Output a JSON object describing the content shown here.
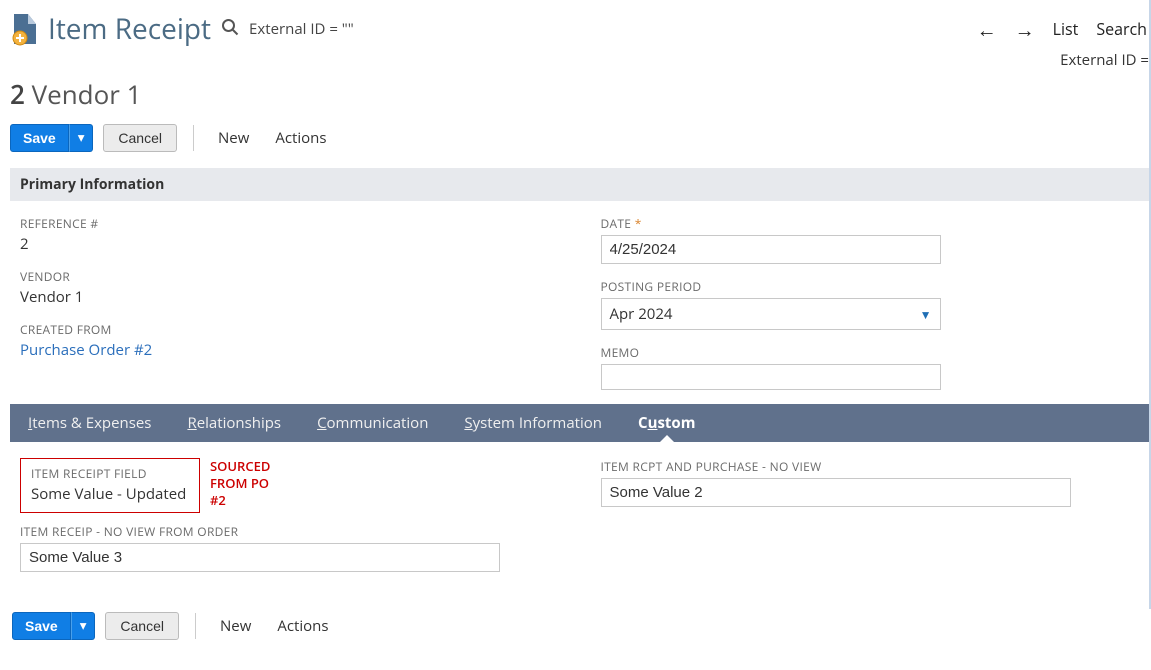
{
  "header": {
    "title": "Item Receipt",
    "filter_text": "External ID = \"\"",
    "nav": {
      "list": "List",
      "search": "Search"
    },
    "sub_right": "External ID ="
  },
  "record": {
    "number": "2",
    "vendor_name": "Vendor 1"
  },
  "buttons": {
    "save": "Save",
    "cancel": "Cancel",
    "new": "New",
    "actions": "Actions"
  },
  "section": {
    "primary": "Primary Information"
  },
  "labels": {
    "reference": "REFERENCE #",
    "vendor": "VENDOR",
    "created_from": "CREATED FROM",
    "date": "DATE",
    "posting_period": "POSTING PERIOD",
    "memo": "MEMO",
    "item_receipt_field": "ITEM RECEIPT FIELD",
    "item_receip_no_view": "ITEM RECEIP - NO VIEW FROM ORDER",
    "item_rcpt_purchase_noview": "ITEM RCPT AND PURCHASE - NO VIEW"
  },
  "values": {
    "reference": "2",
    "vendor": "Vendor 1",
    "created_from_text": "Purchase Order #2",
    "date": "4/25/2024",
    "posting_period": "Apr 2024",
    "memo": "",
    "item_receipt_field": "Some Value - Updated",
    "item_receip_no_view": "Some Value 3",
    "item_rcpt_purchase_noview": "Some Value 2"
  },
  "tabs": {
    "items_expenses_pre": "I",
    "items_expenses_rest": "tems & Expenses",
    "relationships_pre": "R",
    "relationships_rest": "elationships",
    "communication_pre": "C",
    "communication_rest": "ommunication",
    "system_info_pre": "S",
    "system_info_rest": "ystem Information",
    "custom_pre": "C",
    "custom_rest": "u",
    "custom_rest2": "stom"
  },
  "callout": {
    "line1": "SOURCED",
    "line2": "FROM PO",
    "line3": "#2"
  }
}
